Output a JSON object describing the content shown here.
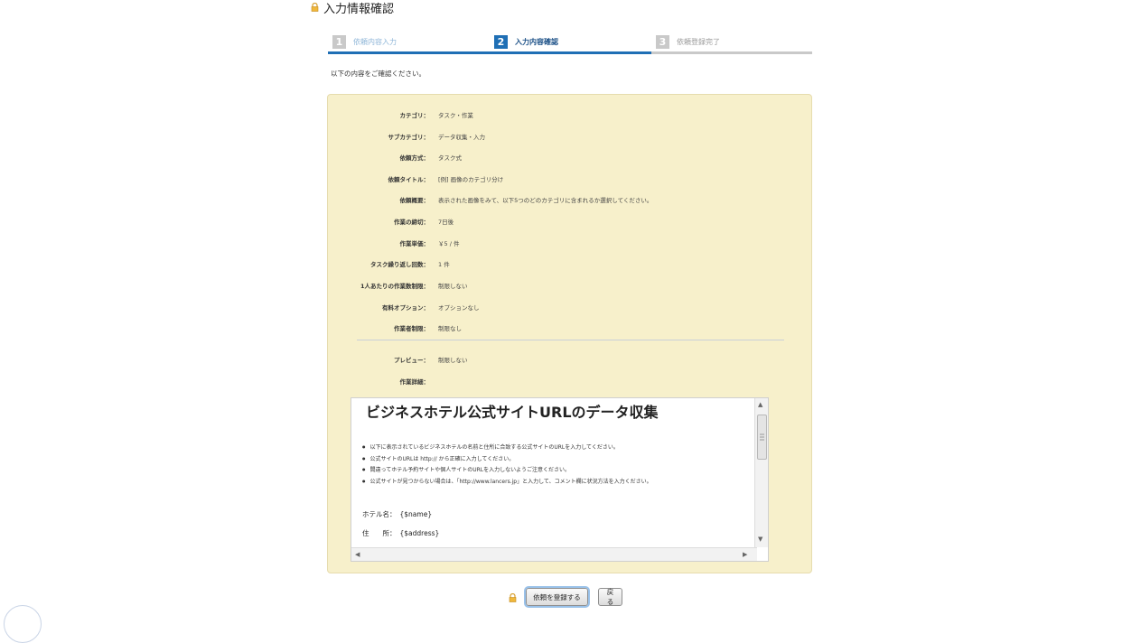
{
  "page": {
    "title": "入力情報確認"
  },
  "steps": [
    {
      "num": "1",
      "label": "依頼内容入力"
    },
    {
      "num": "2",
      "label": "入力内容確認"
    },
    {
      "num": "3",
      "label": "依頼登録完了"
    }
  ],
  "intro": "以下の内容をご確認ください。",
  "details": [
    {
      "label": "カテゴリ：",
      "value": "タスク・作業"
    },
    {
      "label": "サブカテゴリ：",
      "value": "データ収集・入力"
    },
    {
      "label": "依頼方式：",
      "value": "タスク式"
    },
    {
      "label": "依頼タイトル：",
      "value": "[例] 画像のカテゴリ分け"
    },
    {
      "label": "依頼概要：",
      "value": "表示された画像をみて、以下5つのどのカテゴリに含まれるか選択してください。"
    },
    {
      "label": "作業の締切：",
      "value": "7日後"
    },
    {
      "label": "作業単価：",
      "value": "￥5 / 件"
    },
    {
      "label": "タスク繰り返し回数：",
      "value": "1 件"
    },
    {
      "label": "1人あたりの作業数制限：",
      "value": "制限しない"
    },
    {
      "label": "有料オプション：",
      "value": "オプションなし"
    },
    {
      "label": "作業者制限：",
      "value": "制限なし"
    }
  ],
  "details2": [
    {
      "label": "プレビュー：",
      "value": "制限しない"
    },
    {
      "label": "作業詳細：",
      "value": ""
    }
  ],
  "preview": {
    "title": "ビジネスホテル公式サイトURLのデータ収集",
    "bullets": [
      "以下に表示されているビジネスホテルの名前と住所に合致する公式サイトのURLを入力してください。",
      "公式サイトのURLは http:// から正確に入力してください。",
      "間違ってホテル予約サイトや個人サイトのURLを入力しないようご注意ください。",
      "公式サイトが見つからない場合は、「http://www.lancers.jp」と入力して、コメント欄に状況方法を入力ください。"
    ],
    "fields": [
      {
        "label": "ホテル名：",
        "value": "{$name}"
      },
      {
        "label": "住　　所：",
        "value": "{$address}"
      }
    ]
  },
  "buttons": {
    "submit": "依頼を登録する",
    "back": "戻る"
  },
  "colors": {
    "accent": "#1f6fb5",
    "panel": "#f7f0cb",
    "step_line_done": "#1f6fb5",
    "step_line_todo": "#c9c9c9"
  }
}
